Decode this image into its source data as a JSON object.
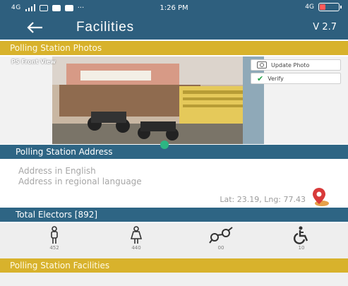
{
  "status_bar": {
    "network": "4G",
    "more": "···",
    "time": "1:26 PM",
    "right_network": "4G"
  },
  "app_bar": {
    "title": "Facilities",
    "version": "V 2.7"
  },
  "photos_section": {
    "header": "Polling Station Photos",
    "photo_caption": "PS Front View",
    "update_photo_label": "Update Photo",
    "verify_label": "Verify"
  },
  "address_section": {
    "header": "Polling Station Address",
    "address_english": "Address in English",
    "address_regional": "Address in regional language",
    "lat_lng": "Lat: 23.19, Lng: 77.43"
  },
  "electors_section": {
    "header": "Total Electors [892]",
    "groups": [
      {
        "icon": "male-icon",
        "count": "452"
      },
      {
        "icon": "female-icon",
        "count": "440"
      },
      {
        "icon": "third-gender-icon",
        "count": "00"
      },
      {
        "icon": "wheelchair-icon",
        "count": "10"
      }
    ]
  },
  "facilities_section": {
    "header": "Polling Station Facilities"
  },
  "colors": {
    "primary": "#2e5f7e",
    "section_blue": "#2e6584",
    "accent_gold": "#d8b22c",
    "verify_green": "#21a144"
  }
}
